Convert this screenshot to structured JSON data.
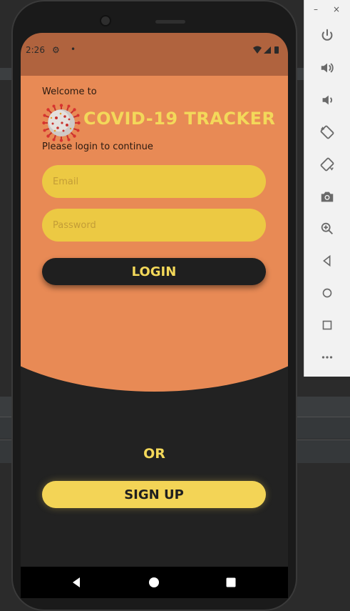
{
  "status_bar": {
    "time": "2:26",
    "settings_icon": "gear-icon",
    "notification_dot": "•",
    "icons": [
      "wifi-icon",
      "signal-icon",
      "battery-icon"
    ]
  },
  "login_screen": {
    "welcome_text": "Welcome to",
    "app_title": "COVID-19 TRACKER",
    "logo_icon": "virus-icon",
    "subtitle": "Please login to continue",
    "email_placeholder": "Email",
    "password_placeholder": "Password",
    "login_label": "LOGIN",
    "or_text": "OR",
    "signup_label": "SIGN UP"
  },
  "nav_bar": {
    "buttons": [
      "back-icon",
      "home-icon",
      "recents-icon"
    ]
  },
  "emulator_panel": {
    "window_controls": {
      "minimize": "–",
      "close": "×"
    },
    "buttons": [
      "power-icon",
      "volume-up-icon",
      "volume-down-icon",
      "rotate-left-icon",
      "rotate-right-icon",
      "camera-icon",
      "zoom-icon",
      "back-icon",
      "home-icon",
      "overview-icon",
      "more-icon"
    ]
  },
  "colors": {
    "orange": "#e88a55",
    "status_bar": "#b0633e",
    "yellow": "#f3d456",
    "input_yellow": "#ecc943",
    "dark": "#1f1f1f"
  }
}
